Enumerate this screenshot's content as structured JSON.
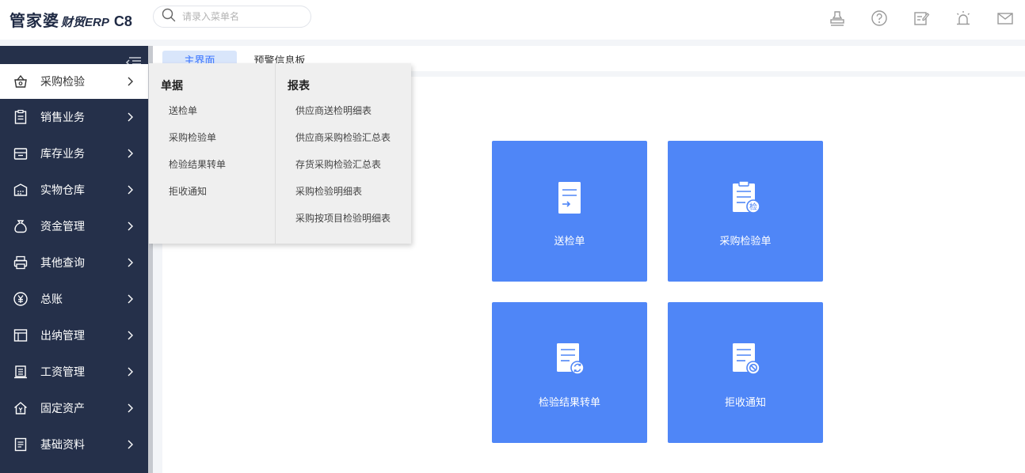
{
  "header": {
    "logo_main": "管家婆",
    "logo_sub": "财贸ERP",
    "logo_version": "C8",
    "search_placeholder": "请录入菜单名",
    "icons": [
      "stamp-icon",
      "help-icon",
      "edit-icon",
      "alarm-icon",
      "mail-icon"
    ]
  },
  "sidebar": {
    "items": [
      {
        "label": "采购检验",
        "icon": "basket-icon",
        "active": true
      },
      {
        "label": "销售业务",
        "icon": "clipboard-icon"
      },
      {
        "label": "库存业务",
        "icon": "inventory-icon"
      },
      {
        "label": "实物仓库",
        "icon": "warehouse-icon"
      },
      {
        "label": "资金管理",
        "icon": "money-bag-icon"
      },
      {
        "label": "其他查询",
        "icon": "printer-icon"
      },
      {
        "label": "总账",
        "icon": "yen-icon"
      },
      {
        "label": "出纳管理",
        "icon": "layout-icon"
      },
      {
        "label": "工资管理",
        "icon": "building-icon"
      },
      {
        "label": "固定资产",
        "icon": "house-icon"
      },
      {
        "label": "基础资料",
        "icon": "doc-list-icon"
      }
    ]
  },
  "tabs": [
    {
      "label": "主界面",
      "active": true
    },
    {
      "label": "预警信息板",
      "active": false
    }
  ],
  "dropdown": {
    "left": {
      "title": "单据",
      "items": [
        "送检单",
        "采购检验单",
        "检验结果转单",
        "拒收通知"
      ]
    },
    "right": {
      "title": "报表",
      "items": [
        "供应商送检明细表",
        "供应商采购检验汇总表",
        "存货采购检验汇总表",
        "采购检验明细表",
        "采购按项目检验明细表"
      ]
    }
  },
  "tiles": [
    {
      "label": "送检单",
      "icon": "send-inspection-icon"
    },
    {
      "label": "采购检验单",
      "icon": "inspection-clipboard-icon"
    },
    {
      "label": "检验结果转单",
      "icon": "transfer-doc-icon"
    },
    {
      "label": "拒收通知",
      "icon": "reject-doc-icon"
    }
  ],
  "colors": {
    "sidebar_bg": "#25304a",
    "tile_bg": "#4f86f7",
    "accent": "#3370ff",
    "active_tab_bg": "#d9e6fb"
  },
  "tile_badge": "检"
}
